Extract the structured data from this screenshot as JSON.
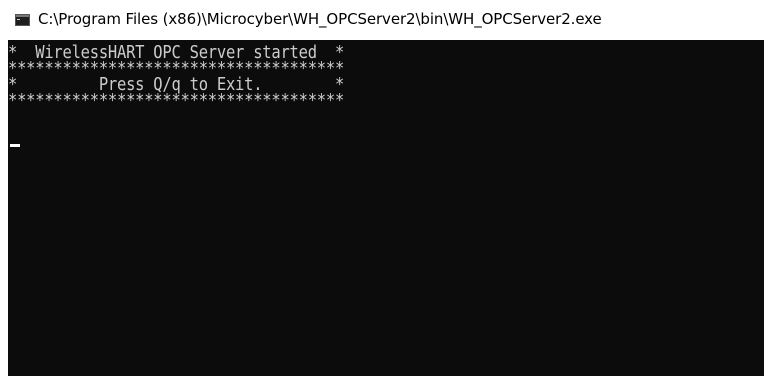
{
  "window": {
    "title": "C:\\Program Files (x86)\\Microcyber\\WH_OPCServer2\\bin\\WH_OPCServer2.exe",
    "icon": "console-app-icon"
  },
  "console": {
    "background": "#0c0c0c",
    "foreground": "#cccccc",
    "lines": [
      "*  WirelessHART OPC Server started  *",
      "*************************************",
      "*         Press Q/q to Exit.        *",
      "*************************************"
    ],
    "cursor": "block-underline"
  }
}
